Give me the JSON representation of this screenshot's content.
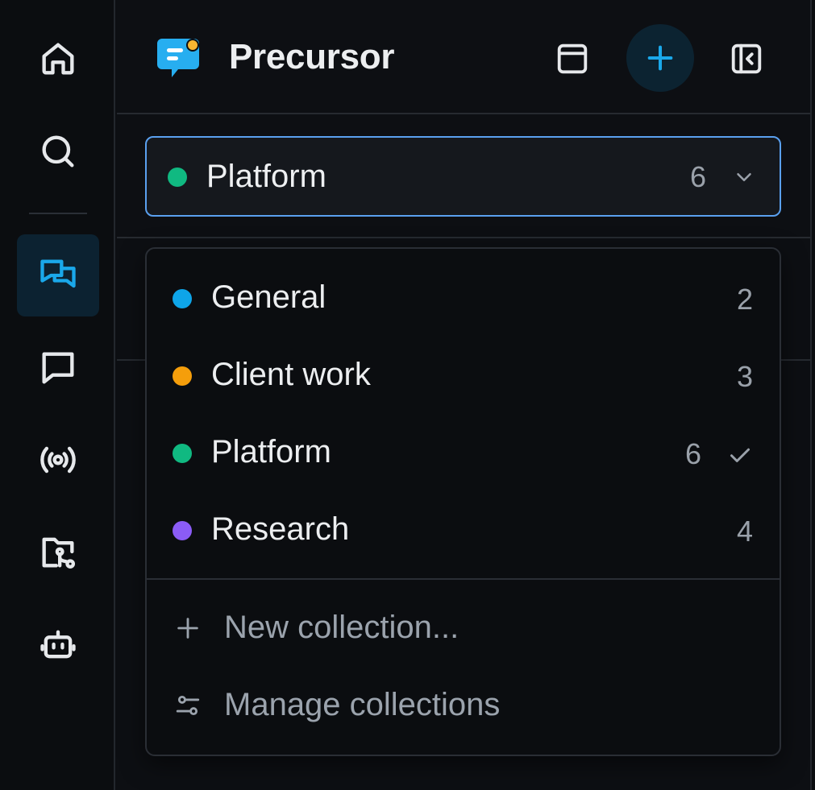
{
  "app": {
    "title": "Precursor"
  },
  "rail": {
    "items": [
      {
        "icon": "home-icon"
      },
      {
        "icon": "search-icon"
      },
      {
        "icon": "chats-icon",
        "active": true
      },
      {
        "icon": "message-icon"
      },
      {
        "icon": "broadcast-icon"
      },
      {
        "icon": "folder-git-icon"
      },
      {
        "icon": "bot-icon"
      }
    ]
  },
  "header": {
    "layout_icon": "layout-icon",
    "add_icon": "plus-icon",
    "collapse_icon": "collapse-sidebar-icon"
  },
  "selector": {
    "label": "Platform",
    "count": "6",
    "color": "#10b981"
  },
  "dropdown": {
    "items": [
      {
        "label": "General",
        "count": "2",
        "color": "#0ea5e9",
        "selected": false
      },
      {
        "label": "Client work",
        "count": "3",
        "color": "#f59e0b",
        "selected": false
      },
      {
        "label": "Platform",
        "count": "6",
        "color": "#10b981",
        "selected": true
      },
      {
        "label": "Research",
        "count": "4",
        "color": "#8b5cf6",
        "selected": false
      }
    ],
    "actions": [
      {
        "label": "New collection...",
        "icon": "plus-icon"
      },
      {
        "label": "Manage collections",
        "icon": "sliders-icon"
      }
    ]
  },
  "colors": {
    "accent": "#0ea5e9",
    "focus_border": "#5aa0ef"
  }
}
